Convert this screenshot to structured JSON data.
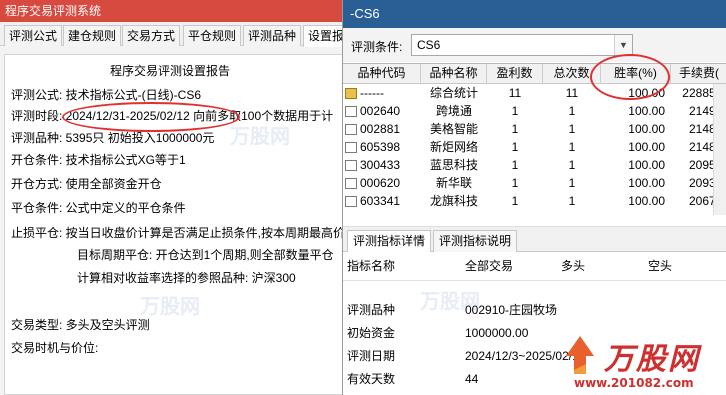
{
  "left_window": {
    "title": "程序交易评测系统",
    "tabs": [
      "评测公式",
      "建仓规则",
      "交易方式",
      "平仓规则",
      "评测品种",
      "设置报"
    ],
    "report": {
      "title": "程序交易评测设置报告",
      "lines": [
        "评测公式:  技术指标公式-(日线)-CS6",
        "评测时段:  2024/12/31-2025/02/12 向前多取100个数据用于计",
        "评测品种:  5395只 初始投入1000000元",
        "开仓条件:  技术指标公式XG等于1",
        "开仓方式:  使用全部资金开仓",
        "平仓条件:  公式中定义的平仓条件",
        "止损平仓:  按当日收盘价计算是否满足止损条件,按本周期最高价",
        "目标周期平仓:  开仓达到1个周期,则全部数量平仓",
        "计算相对收益率选择的参照品种:  沪深300",
        "交易类型:  多头及空头评测",
        "交易时机与价位:"
      ]
    }
  },
  "right_window": {
    "title": "-CS6",
    "condition_label": "评测条件:",
    "condition_value": "CS6",
    "table": {
      "headers": [
        "品种代码",
        "品种名称",
        "盈利数",
        "总次数",
        "胜率(%)",
        "手续费("
      ],
      "rows": [
        {
          "code": "------",
          "name": "综合统计",
          "profit": "11",
          "total": "11",
          "win_rate": "100.00",
          "fee": "22885.",
          "highlight": true
        },
        {
          "code": "002640",
          "name": "跨境通",
          "profit": "1",
          "total": "1",
          "win_rate": "100.00",
          "fee": "2149.",
          "highlight": false
        },
        {
          "code": "002881",
          "name": "美格智能",
          "profit": "1",
          "total": "1",
          "win_rate": "100.00",
          "fee": "2148.",
          "highlight": false
        },
        {
          "code": "605398",
          "name": "新炬网络",
          "profit": "1",
          "total": "1",
          "win_rate": "100.00",
          "fee": "2148.",
          "highlight": false
        },
        {
          "code": "300433",
          "name": "蓝思科技",
          "profit": "1",
          "total": "1",
          "win_rate": "100.00",
          "fee": "2095.",
          "highlight": false
        },
        {
          "code": "000620",
          "name": "新华联",
          "profit": "1",
          "total": "1",
          "win_rate": "100.00",
          "fee": "2093.",
          "highlight": false
        },
        {
          "code": "603341",
          "name": "龙旗科技",
          "profit": "1",
          "total": "1",
          "win_rate": "100.00",
          "fee": "2067.",
          "highlight": false
        }
      ]
    },
    "bottom_tabs": [
      "评测指标详情",
      "评测指标说明"
    ],
    "detail": {
      "headers": [
        "指标名称",
        "全部交易",
        "多头",
        "空头"
      ],
      "rows": [
        {
          "name": "评测品种",
          "value": "002910-庄园牧场"
        },
        {
          "name": "初始资金",
          "value": "1000000.00"
        },
        {
          "name": "评测日期",
          "value": "2024/12/3~2025/02/12"
        },
        {
          "name": "有效天数",
          "value": "44"
        }
      ]
    }
  },
  "watermark": {
    "logo_text": "万股网",
    "url": "www.201082.com",
    "faint_text": "万股网"
  },
  "colors": {
    "left_title_bar": "#d64a3f",
    "right_title_bar": "#2a5f95",
    "annotation_red": "#e03030",
    "watermark_red": "#cf2f2f"
  }
}
